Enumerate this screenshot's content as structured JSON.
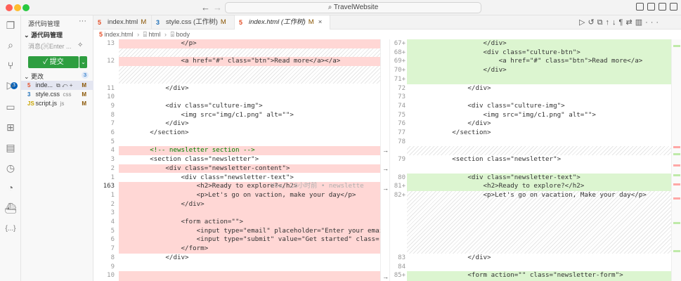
{
  "window": {
    "search_text": "TravelWebsite"
  },
  "sidebar": {
    "title": "源代码管理",
    "section": "源代码管理",
    "commit_placeholder": "消息(⌘Enter ...",
    "commit_label": "✓ 提交",
    "changes_label": "更改",
    "changes_count": "3",
    "files": [
      {
        "name": "inde...",
        "icon": "html-icon",
        "status": "M"
      },
      {
        "name": "style.css",
        "dir": "css",
        "icon": "css-icon",
        "status": "M"
      },
      {
        "name": "script.js",
        "dir": "js",
        "icon": "js-icon",
        "status": "M"
      }
    ]
  },
  "tabs": [
    {
      "label": "index.html",
      "status": "M"
    },
    {
      "label": "style.css (工作树)",
      "status": "M"
    },
    {
      "label": "index.html (工作树)",
      "status": "M"
    }
  ],
  "breadcrumb": [
    "index.html",
    "html",
    "body"
  ],
  "left_lines": [
    {
      "num": "13",
      "code": "                </p>"
    },
    {
      "num": "12",
      "code": "                <a href=\"#\" class=\"btn\">Read more</a></a>"
    },
    {
      "num": "11",
      "code": "            </div>"
    },
    {
      "num": "10",
      "code": ""
    },
    {
      "num": "9",
      "code": "            <div class=\"culture-img\">"
    },
    {
      "num": "8",
      "code": "                <img src=\"img/c1.png\" alt=\"\">"
    },
    {
      "num": "7",
      "code": "            </div>"
    },
    {
      "num": "6",
      "code": "        </section>"
    },
    {
      "num": "5",
      "code": ""
    },
    {
      "num": "4",
      "code": "        <!-- newsletter section -->"
    },
    {
      "num": "3",
      "code": "        <section class=\"newsletter\">"
    },
    {
      "num": "2",
      "code": "            <div class=\"newsletter-content\">"
    },
    {
      "num": "1",
      "code": "                <div class=\"newsletter-text\">"
    },
    {
      "num": "163",
      "code": "                    <h2>Ready to explore?</h2>"
    },
    {
      "num": "1",
      "code": "                    <p>Let's go on vaction, make your day</p>"
    },
    {
      "num": "2",
      "code": "                </div>"
    },
    {
      "num": "3",
      "code": ""
    },
    {
      "num": "4",
      "code": "                <form action=\"\">"
    },
    {
      "num": "5",
      "code": "                    <input type=\"email\" placeholder=\"Enter your email...\" req"
    },
    {
      "num": "6",
      "code": "                    <input type=\"submit\" value=\"Get started\" class=\"btn\">"
    },
    {
      "num": "7",
      "code": "                </form>"
    },
    {
      "num": "8",
      "code": "            </div>"
    },
    {
      "num": "9",
      "code": ""
    },
    {
      "num": "10",
      "code": ""
    }
  ],
  "blame_ghost": "You, 18小时前 • newslette",
  "right_lines": [
    {
      "num": "67+",
      "code": "                </div>"
    },
    {
      "num": "68+",
      "code": "                <div class=\"culture-btn\">"
    },
    {
      "num": "69+",
      "code": "                    <a href=\"#\" class=\"btn\">Read more</a>"
    },
    {
      "num": "70+",
      "code": "                </div>"
    },
    {
      "num": "71+",
      "code": ""
    },
    {
      "num": "72",
      "code": "            </div>"
    },
    {
      "num": "73",
      "code": ""
    },
    {
      "num": "74",
      "code": "            <div class=\"culture-img\">"
    },
    {
      "num": "75",
      "code": "                <img src=\"img/c1.png\" alt=\"\">"
    },
    {
      "num": "76",
      "code": "            </div>"
    },
    {
      "num": "77",
      "code": "        </section>"
    },
    {
      "num": "78",
      "code": ""
    },
    {
      "num": "79",
      "code": "        <section class=\"newsletter\">"
    },
    {
      "num": "80",
      "code": "            <div class=\"newsletter-text\">"
    },
    {
      "num": "81+",
      "code": "                <h2>Ready to explore?</h2>"
    },
    {
      "num": "82+",
      "code": "                <p>Let's go on vacation, Make your day</p>"
    },
    {
      "num": "83",
      "code": "            </div>"
    },
    {
      "num": "84",
      "code": ""
    },
    {
      "num": "85+",
      "code": "            <form action=\"\" class=\"newsletter-form\">"
    }
  ]
}
